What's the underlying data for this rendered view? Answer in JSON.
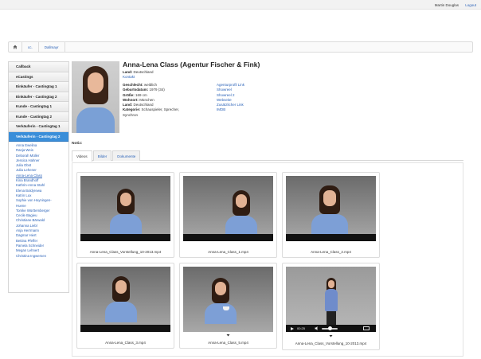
{
  "header": {
    "user": "Martin Douglas",
    "logout": "Logout"
  },
  "breadcrumb": [
    "cc.",
    "Dallmayr"
  ],
  "sidebar": {
    "buttons": [
      "Callback",
      "eCastings",
      "Einkäufer - Castingtag 1",
      "Einkäufer - Castingtag 2",
      "Kunde - Castingtag 1",
      "Kunde - Castingtag 2",
      "Verkäuferin - Castingtag 1",
      "Verkäuferin - Castingtag 2"
    ],
    "people": [
      "Anna Ewelina",
      "Ranja Weis",
      "Deborah Müller",
      "Jessica Hahner",
      "Julia Obst",
      "Julia Lehener",
      "Anna-Lena Class",
      "Kina Brandhoff",
      "Kathrin-Anna Stahl",
      "Elena Boldyrewa",
      "Katrin Lux",
      "Sophie von Hoyningen-",
      "Huene",
      "Tomke Württemberger",
      "Cecile Bagieu",
      "Christiane Bärwald",
      "Johanna Liebl",
      "Anja Herrmann",
      "Dagmar Hiert",
      "Bettina Pfeffer",
      "Pamela Schneider",
      "Megan Lehnert",
      "Christina Ingwersen"
    ]
  },
  "profile": {
    "name": "Anna-Lena Class (Agentur Fischer & Fink)",
    "land_label": "Land:",
    "land_value": "Deutschland",
    "kontakt": "Kontakt",
    "details": [
      {
        "label": "Geschlecht:",
        "value": "weiblich"
      },
      {
        "label": "Geburtsdatum:",
        "value": "1979 (34)"
      },
      {
        "label": "Größe:",
        "value": "169 cm"
      },
      {
        "label": "Wohnort:",
        "value": "München"
      },
      {
        "label": "Land:",
        "value": "Deutschland"
      },
      {
        "label": "Kategorie:",
        "value": "Schauspieler, Sprecher,"
      }
    ],
    "kategorie_cont": "Synchron",
    "links": [
      "Agenturprofil Link",
      "Showreel",
      "Showreel 2",
      "Webseite",
      "Zusätzlicher Link",
      "IMDB"
    ]
  },
  "notiz_label": "Notiz:",
  "tabs": [
    "Videos",
    "Bilder",
    "Dokumente"
  ],
  "videos": [
    {
      "file": "Anna-Lena_Class_Vorstellung_10-2013.mp4"
    },
    {
      "file": "Anna-Lena_Class_1.mp4"
    },
    {
      "file": "Anna-Lena_Class_2.mp4"
    },
    {
      "file": "Anna-Lena_Class_3.mp4"
    },
    {
      "file": "Anna-Lena_Class_5.mp4"
    },
    {
      "file": "Anna-Lena_Class_Vorstellung_10-2013.mp4"
    }
  ],
  "player": {
    "time": "00:25"
  },
  "icons": {
    "home": "home-icon",
    "download": "download-icon"
  },
  "colors": {
    "accent": "#3a8ed9",
    "link": "#2a62b8"
  }
}
